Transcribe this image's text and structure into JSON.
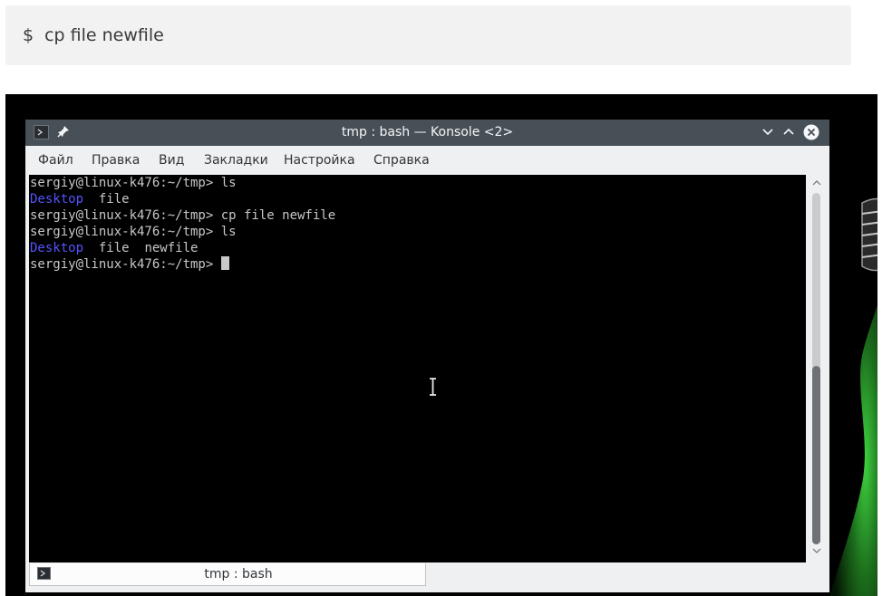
{
  "code_block": {
    "prompt": "$",
    "command": "cp file newfile"
  },
  "window": {
    "title": "tmp : bash — Konsole <2>",
    "menu": [
      "Файл",
      "Правка",
      "Вид",
      "Закладки",
      "Настройка",
      "Справка"
    ]
  },
  "terminal": {
    "lines": [
      {
        "prompt": "sergiy@linux-k476:~/tmp> ",
        "cmd": "ls"
      },
      {
        "out_blue": "Desktop",
        "out": "  file"
      },
      {
        "prompt": "sergiy@linux-k476:~/tmp> ",
        "cmd": "cp file newfile"
      },
      {
        "prompt": "sergiy@linux-k476:~/tmp> ",
        "cmd": "ls"
      },
      {
        "out_blue": "Desktop",
        "out": "  file  newfile"
      },
      {
        "prompt": "sergiy@linux-k476:~/tmp> ",
        "cmd": ""
      }
    ],
    "scroll_position": 0.51
  },
  "tab": {
    "label": "tmp : bash"
  },
  "colors": {
    "titlebar": "#475057",
    "terminal_bg": "#000000",
    "terminal_fg": "#c8c8c8",
    "dir_blue": "#5454ff"
  }
}
